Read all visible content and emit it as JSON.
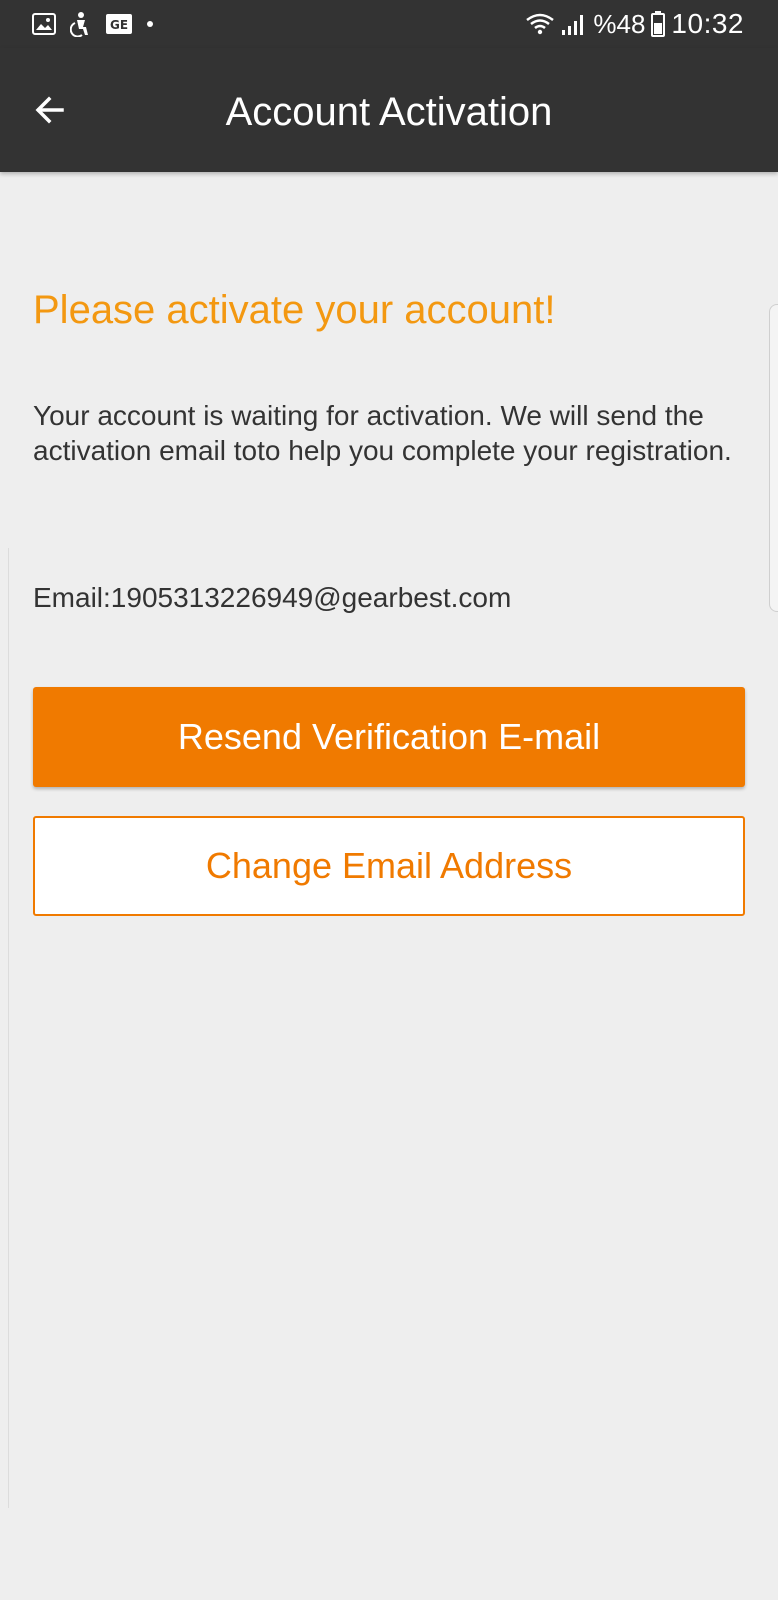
{
  "status_bar": {
    "icons_left": [
      "image-icon",
      "accessibility-icon",
      "ge-icon",
      "dot-icon"
    ],
    "ge_label": "GE",
    "battery_percent": "%48",
    "time": "10:32"
  },
  "app_bar": {
    "back_icon": "arrow-left-icon",
    "title": "Account Activation"
  },
  "content": {
    "heading": "Please activate your account!",
    "message": "Your account is waiting for activation. We will send the activation email toto help you complete your registration.",
    "email": "Email:1905313226949@gearbest.com"
  },
  "buttons": {
    "resend_label": "Resend Verification E-mail",
    "change_email_label": "Change Email Address"
  },
  "colors": {
    "accent": "#f07a00",
    "heading": "#f39811",
    "bar": "#333333",
    "background": "#eeeeee"
  }
}
